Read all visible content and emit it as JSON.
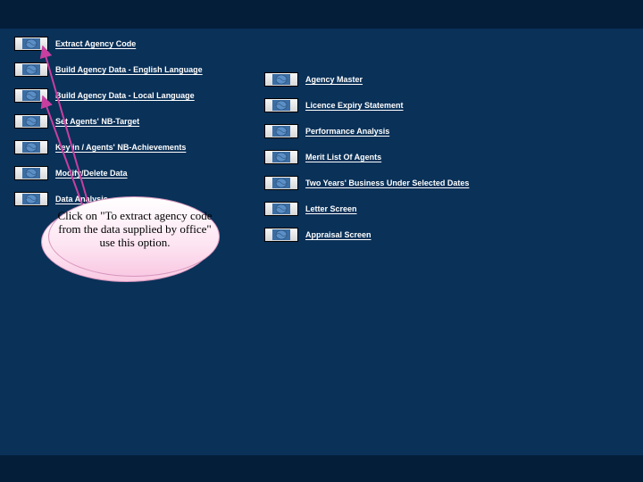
{
  "left_menu": {
    "items": [
      {
        "label": "Extract Agency Code"
      },
      {
        "label": "Build  Agency Data - English Language"
      },
      {
        "label": "Build Agency Data - Local Language"
      },
      {
        "label": "Set  Agents' NB-Target"
      },
      {
        "label": "Key in / Agents' NB-Achievements"
      },
      {
        "label": "Modify/Delete Data"
      },
      {
        "label": "Data Analysis"
      }
    ]
  },
  "right_menu": {
    "items": [
      {
        "label": "Agency Master"
      },
      {
        "label": "Licence Expiry Statement"
      },
      {
        "label": "Performance Analysis"
      },
      {
        "label": "Merit List Of Agents"
      },
      {
        "label": "Two Years' Business Under Selected Dates"
      },
      {
        "label": "Letter Screen"
      },
      {
        "label": "Appraisal  Screen"
      }
    ]
  },
  "callout": {
    "text": "Click on \"To extract agency code  from the data supplied by office\" use this option."
  },
  "icon": {
    "name": "globe-icon"
  }
}
